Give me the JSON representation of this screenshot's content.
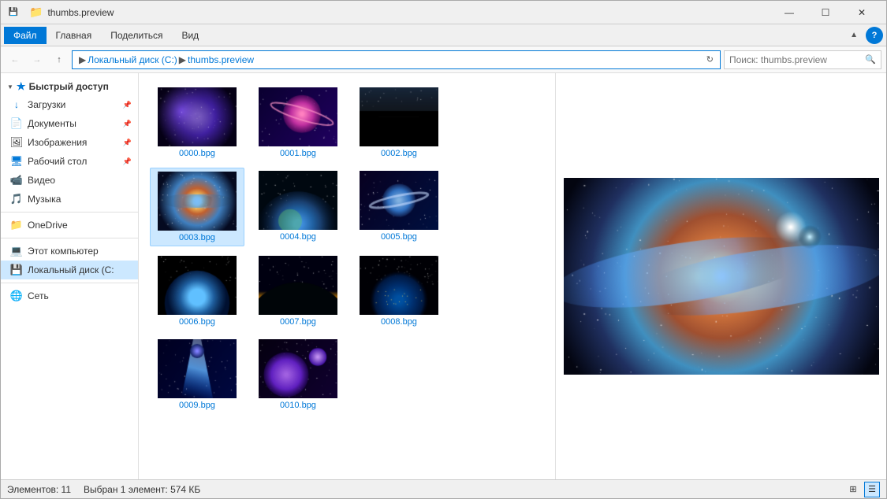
{
  "window": {
    "title": "thumbs.preview",
    "controls": {
      "minimize": "—",
      "maximize": "☐",
      "close": "✕"
    }
  },
  "menu": {
    "items": [
      "Файл",
      "Главная",
      "Поделиться",
      "Вид"
    ]
  },
  "address": {
    "path_parts": [
      "Локальный диск (C:)",
      "thumbs.preview"
    ],
    "search_placeholder": "Поиск: thumbs.preview"
  },
  "sidebar": {
    "quick_access_label": "Быстрый доступ",
    "items": [
      {
        "label": "Загрузки",
        "icon": "download",
        "pinned": true
      },
      {
        "label": "Документы",
        "icon": "doc",
        "pinned": true
      },
      {
        "label": "Изображения",
        "icon": "images",
        "pinned": true
      },
      {
        "label": "Рабочий стол",
        "icon": "desktop",
        "pinned": true
      },
      {
        "label": "Видео",
        "icon": "video"
      },
      {
        "label": "Музыка",
        "icon": "music"
      },
      {
        "label": "OneDrive",
        "icon": "onedrive"
      },
      {
        "label": "Этот компьютер",
        "icon": "computer"
      },
      {
        "label": "Локальный диск (C:",
        "icon": "disk",
        "selected": true
      },
      {
        "label": "Сеть",
        "icon": "network"
      }
    ]
  },
  "files": [
    {
      "name": "0000.bpg",
      "selected": false,
      "color_scheme": "galaxy_purple"
    },
    {
      "name": "0001.bpg",
      "selected": false,
      "color_scheme": "planet_pink"
    },
    {
      "name": "0002.bpg",
      "selected": false,
      "color_scheme": "arch_dark"
    },
    {
      "name": "0003.bpg",
      "selected": true,
      "color_scheme": "galaxy_spiral"
    },
    {
      "name": "0004.bpg",
      "selected": false,
      "color_scheme": "earth_space"
    },
    {
      "name": "0005.bpg",
      "selected": false,
      "color_scheme": "planet_rings"
    },
    {
      "name": "0006.bpg",
      "selected": false,
      "color_scheme": "earth_close"
    },
    {
      "name": "0007.bpg",
      "selected": false,
      "color_scheme": "horizon_glow"
    },
    {
      "name": "0008.bpg",
      "selected": false,
      "color_scheme": "earth_night"
    },
    {
      "name": "0009.bpg",
      "selected": false,
      "color_scheme": "blue_beam"
    },
    {
      "name": "0010.bpg",
      "selected": false,
      "color_scheme": "planets_purple"
    }
  ],
  "status": {
    "item_count": "Элементов: 11",
    "selected_info": "Выбран 1 элемент: 574 КБ"
  }
}
